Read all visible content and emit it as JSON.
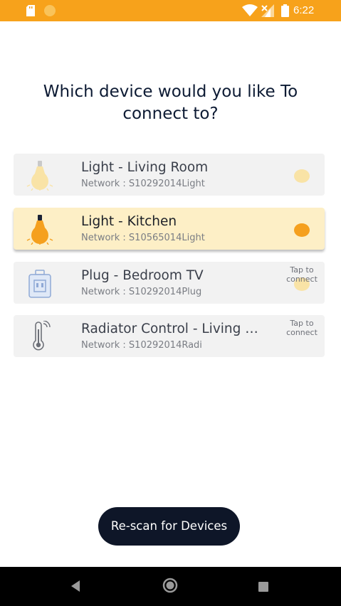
{
  "status_bar": {
    "time": "6:22",
    "icons": [
      "sd-card-icon",
      "notification-circle-icon",
      "wifi-icon",
      "signal-icon",
      "battery-icon"
    ],
    "background": "#f7a21b"
  },
  "prompt": {
    "line1": "Which device would you like To",
    "line2": "connect to?"
  },
  "devices": [
    {
      "name": "Light - Living Room",
      "network": "Network : S10292014Light",
      "icon": "lightbulb-icon",
      "selected": false
    },
    {
      "name": "Light - Kitchen",
      "network": "Network : S10565014Light",
      "icon": "lightbulb-icon",
      "selected": true
    },
    {
      "name": "Plug - Bedroom TV",
      "network": "Network : S10292014Plug",
      "icon": "smart-plug-icon",
      "tap_hint_line1": "Tap to",
      "tap_hint_line2": "connect"
    },
    {
      "name": "Radiator Control - Living Room",
      "network": "Network : S10292014Radi",
      "icon": "thermometer-icon",
      "tap_hint_line1": "Tap to",
      "tap_hint_line2": "connect"
    }
  ],
  "rescan_button": {
    "label": "Re-scan for Devices"
  },
  "colors": {
    "accent": "#f5a01e",
    "selected_card": "#fdefc6",
    "card": "#f2f2f2",
    "button": "#0e1628"
  }
}
